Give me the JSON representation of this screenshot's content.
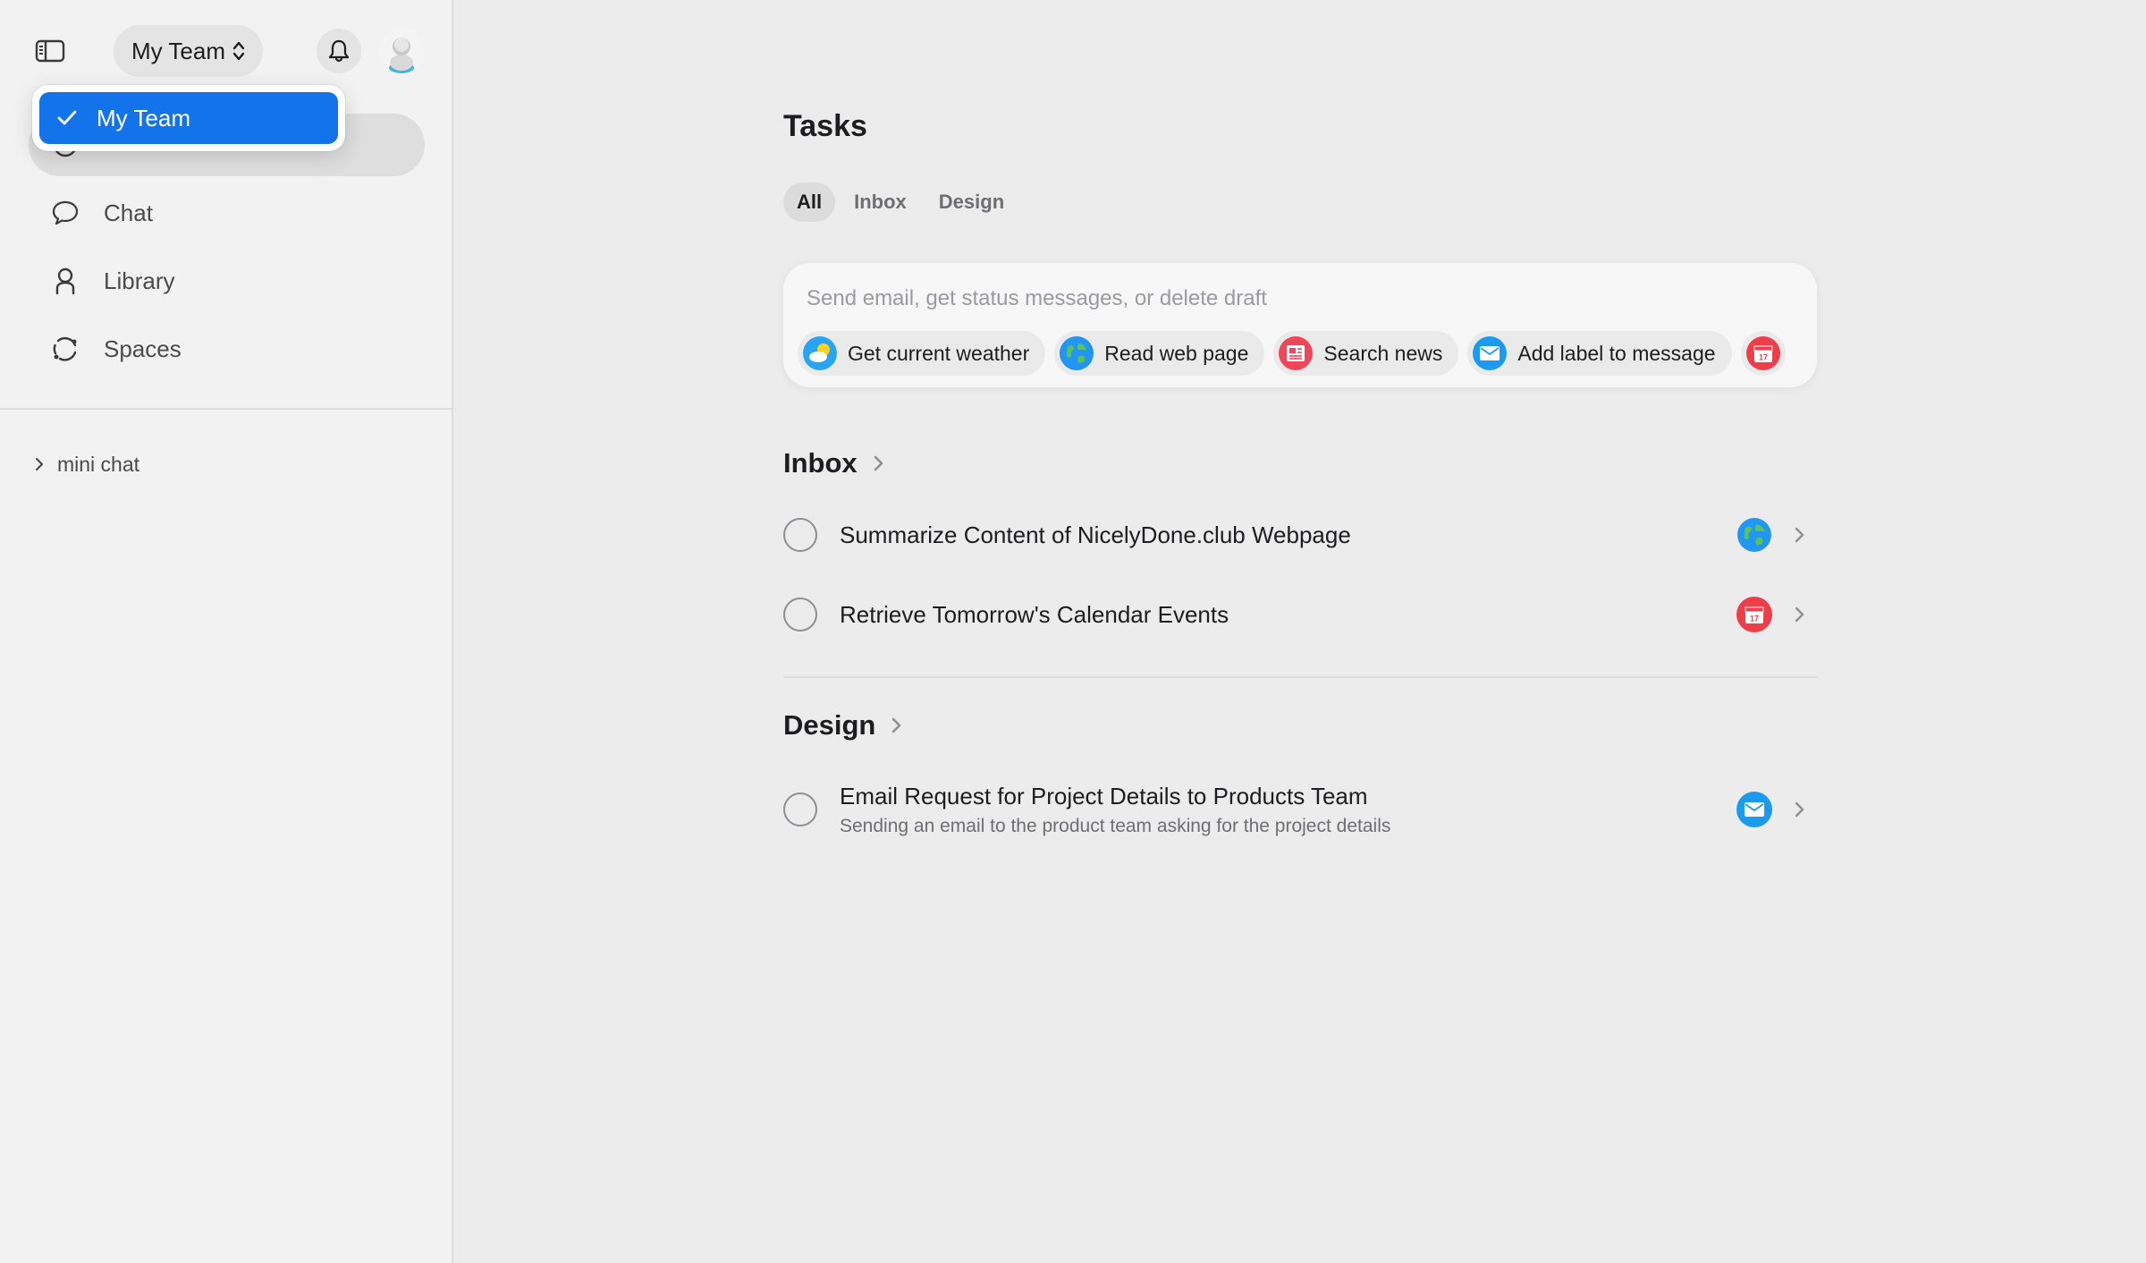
{
  "header": {
    "team_name": "My Team"
  },
  "dropdown": {
    "selected": "My Team"
  },
  "sidebar": {
    "items": [
      {
        "label": "",
        "icon": "clock-icon",
        "active": true
      },
      {
        "label": "Chat",
        "icon": "chat-bubble-icon"
      },
      {
        "label": "Library",
        "icon": "person-icon"
      },
      {
        "label": "Spaces",
        "icon": "orbit-icon"
      }
    ],
    "mini_chat": "mini chat"
  },
  "main": {
    "title": "Tasks",
    "tabs": [
      "All",
      "Inbox",
      "Design"
    ],
    "active_tab": "All",
    "composer": {
      "placeholder": "Send email, get status messages, or delete draft",
      "chips": [
        {
          "label": "Get current weather",
          "icon": "weather-icon"
        },
        {
          "label": "Read web page",
          "icon": "globe-icon"
        },
        {
          "label": "Search news",
          "icon": "news-icon"
        },
        {
          "label": "Add label to message",
          "icon": "mail-icon"
        },
        {
          "label": "",
          "icon": "calendar-icon"
        }
      ]
    },
    "sections": [
      {
        "title": "Inbox",
        "tasks": [
          {
            "title": "Summarize Content of NicelyDone.club Webpage",
            "subtitle": "",
            "app_icon": "globe-icon"
          },
          {
            "title": "Retrieve Tomorrow's Calendar Events",
            "subtitle": "",
            "app_icon": "calendar-icon"
          }
        ]
      },
      {
        "title": "Design",
        "tasks": [
          {
            "title": "Email Request for Project Details to Products Team",
            "subtitle": "Sending an email to the product team asking for the project details",
            "app_icon": "mail-icon"
          }
        ]
      }
    ]
  },
  "colors": {
    "accent": "#1273eb",
    "sidebar_bg": "#f2f2f2",
    "main_bg": "#ececec",
    "news_red": "#f0465a",
    "mail_blue": "#1a9bf0",
    "calendar_red": "#ef3e4a"
  }
}
